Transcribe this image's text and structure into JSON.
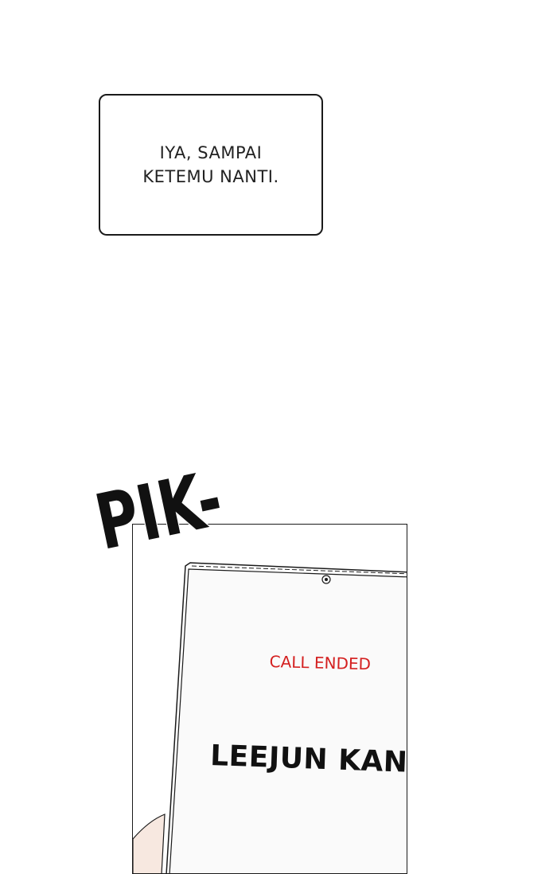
{
  "speech_bubble": {
    "line1": "IYA, SAMPAI",
    "line2": "KETEMU NANTI."
  },
  "sound_effect": {
    "text": "PIK-"
  },
  "phone_screen": {
    "call_status": "CALL ENDED",
    "caller_name": "LEEJUN KANG"
  },
  "colors": {
    "call_status": "#d42020",
    "ink": "#1a1a1a",
    "phone_screen": "#fafafa",
    "skin": "#f7e8e0"
  },
  "icons": {
    "camera": "front-camera-icon"
  }
}
